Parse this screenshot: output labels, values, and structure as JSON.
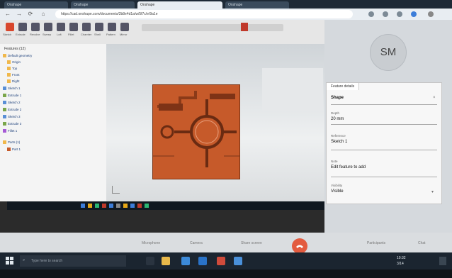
{
  "browser": {
    "tabs": [
      "Onshape",
      "Onshape",
      "Onshape",
      "Onshape"
    ],
    "url": "https://cad.onshape.com/documents/2b8e4d1a/w/5f7c/e/9a1e"
  },
  "toolbar": {
    "labels": [
      "Sketch",
      "Extrude",
      "Revolve",
      "Sweep",
      "Loft",
      "Fillet",
      "Chamfer",
      "Shell",
      "Pattern",
      "Mirror"
    ]
  },
  "tree": {
    "title": "Features (12)",
    "nodes": [
      "Default geometry",
      "Origin",
      "Top",
      "Front",
      "Right",
      "Sketch 1",
      "Extrude 1",
      "Sketch 2",
      "Extrude 2",
      "Sketch 3",
      "Extrude 3",
      "Fillet 1",
      "Parts (1)",
      "Part 1"
    ]
  },
  "panel": {
    "avatar_initials": "SM",
    "tab_label": "Feature details",
    "section_title": "Shape",
    "fields": [
      {
        "label": "Depth",
        "value": "20 mm"
      },
      {
        "label": "Reference",
        "value": "Sketch 1"
      },
      {
        "label": "Note",
        "value": "Edit feature to add"
      },
      {
        "label": "Visibility",
        "value": "Visible"
      }
    ]
  },
  "meeting": {
    "controls": [
      "Microphone",
      "Camera",
      "Share screen",
      "Participants",
      "Chat"
    ],
    "end_icon": "phone-end-icon"
  },
  "taskbar": {
    "search_placeholder": "Type here to search",
    "clock_time": "10:32",
    "clock_date": "3/14"
  },
  "colors": {
    "part": "#c65a2a",
    "end_call": "#e35b3f"
  }
}
